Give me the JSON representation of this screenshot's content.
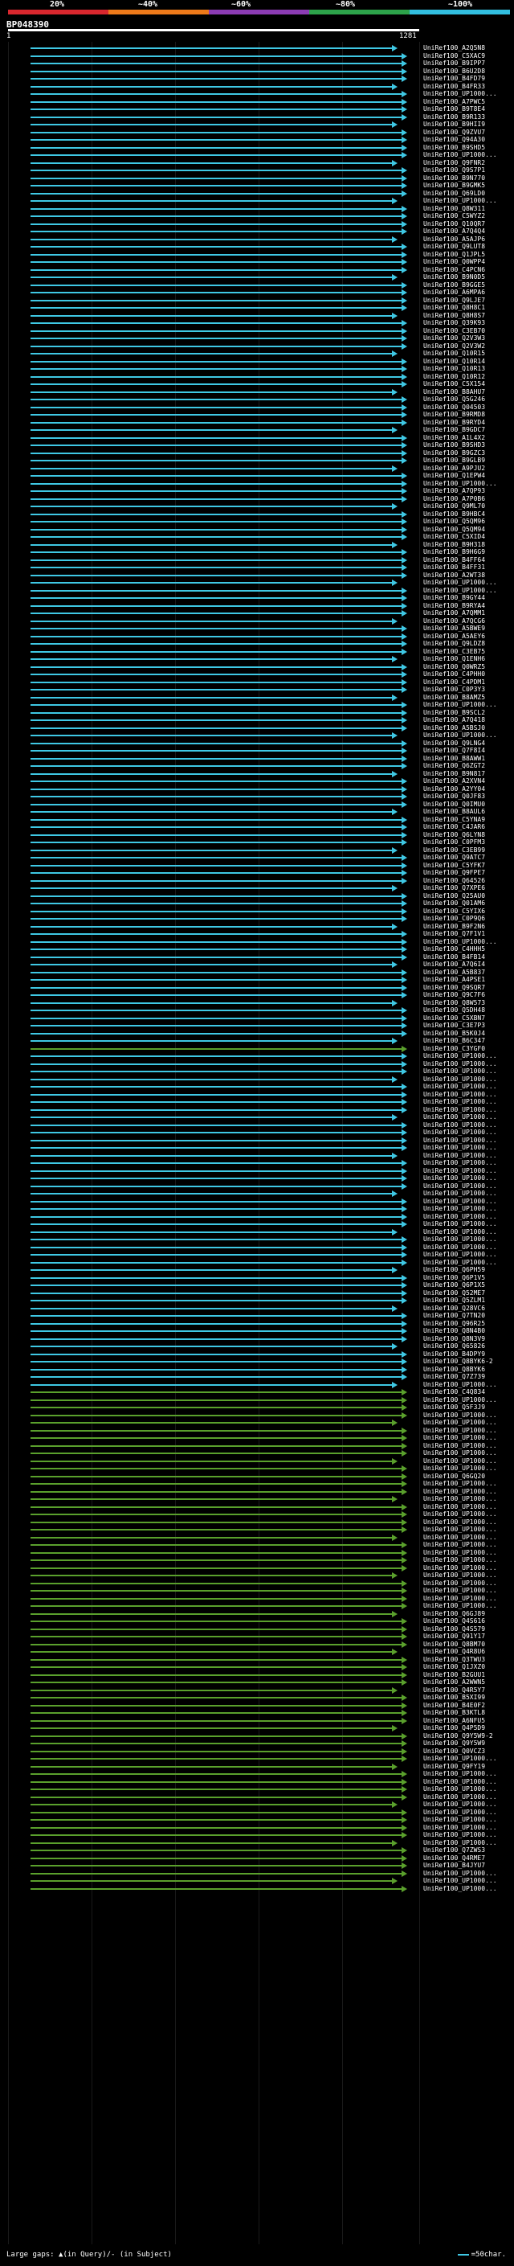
{
  "scale": {
    "labels": [
      "20%",
      "~40%",
      "~60%",
      "~80%",
      "~100%"
    ],
    "colors": [
      "#d9272e",
      "#ee7a1a",
      "#8c3cb4",
      "#2da34a",
      "#32bfe0"
    ]
  },
  "query": {
    "id": "BP048390",
    "start": "1",
    "end": "1281"
  },
  "colors": {
    "cyan": "#3fc8e4",
    "green": "#5aa02c",
    "grey": "#4a4a4a"
  },
  "rows": [
    {
      "label": "UniRef100_A2Q5N8",
      "color": "cyan"
    },
    {
      "label": "UniRef100_C5XAC9",
      "color": "cyan"
    },
    {
      "label": "UniRef100_B9IPP7",
      "color": "cyan"
    },
    {
      "label": "UniRef100_B6U2D8",
      "color": "cyan"
    },
    {
      "label": "UniRef100_B4FD79",
      "color": "cyan"
    },
    {
      "label": "UniRef100_B4FR33",
      "color": "cyan"
    },
    {
      "label": "UniRef100_UP1000...",
      "color": "cyan"
    },
    {
      "label": "UniRef100_A7PWC5",
      "color": "cyan"
    },
    {
      "label": "UniRef100_B9T8E4",
      "color": "cyan"
    },
    {
      "label": "UniRef100_B9R133",
      "color": "cyan"
    },
    {
      "label": "UniRef100_B9HII9",
      "color": "cyan"
    },
    {
      "label": "UniRef100_Q9ZVU7",
      "color": "cyan"
    },
    {
      "label": "UniRef100_Q94A30",
      "color": "cyan"
    },
    {
      "label": "UniRef100_B9SHD5",
      "color": "cyan"
    },
    {
      "label": "UniRef100_UP1000...",
      "color": "cyan"
    },
    {
      "label": "UniRef100_Q9FNR2",
      "color": "cyan"
    },
    {
      "label": "UniRef100_Q9S7P1",
      "color": "cyan"
    },
    {
      "label": "UniRef100_B9N770",
      "color": "cyan"
    },
    {
      "label": "UniRef100_B9GMK5",
      "color": "cyan"
    },
    {
      "label": "UniRef100_Q69LD0",
      "color": "cyan"
    },
    {
      "label": "UniRef100_UP1000...",
      "color": "cyan"
    },
    {
      "label": "UniRef100_Q8W311",
      "color": "cyan"
    },
    {
      "label": "UniRef100_C5WYZ2",
      "color": "cyan"
    },
    {
      "label": "UniRef100_Q10QR7",
      "color": "cyan"
    },
    {
      "label": "UniRef100_A7Q4Q4",
      "color": "cyan"
    },
    {
      "label": "UniRef100_A5AJP6",
      "color": "cyan"
    },
    {
      "label": "UniRef100_Q9LUT8",
      "color": "cyan"
    },
    {
      "label": "UniRef100_Q1JPL5",
      "color": "cyan"
    },
    {
      "label": "UniRef100_Q0WPP4",
      "color": "cyan"
    },
    {
      "label": "UniRef100_C4PCN6",
      "color": "cyan"
    },
    {
      "label": "UniRef100_B9N0D5",
      "color": "cyan"
    },
    {
      "label": "UniRef100_B9GGE5",
      "color": "cyan"
    },
    {
      "label": "UniRef100_A6MPA6",
      "color": "cyan"
    },
    {
      "label": "UniRef100_Q9LJE7",
      "color": "cyan"
    },
    {
      "label": "UniRef100_Q8H8C1",
      "color": "cyan"
    },
    {
      "label": "UniRef100_Q8H8S7",
      "color": "cyan"
    },
    {
      "label": "UniRef100_Q39K93",
      "color": "cyan"
    },
    {
      "label": "UniRef100_C3EB70",
      "color": "cyan"
    },
    {
      "label": "UniRef100_Q2V3W3",
      "color": "cyan"
    },
    {
      "label": "UniRef100_Q2V3W2",
      "color": "cyan"
    },
    {
      "label": "UniRef100_Q10R15",
      "color": "cyan"
    },
    {
      "label": "UniRef100_Q10R14",
      "color": "cyan"
    },
    {
      "label": "UniRef100_Q10R13",
      "color": "cyan"
    },
    {
      "label": "UniRef100_Q10R12",
      "color": "cyan"
    },
    {
      "label": "UniRef100_C5X154",
      "color": "cyan"
    },
    {
      "label": "UniRef100_B8AHU7",
      "color": "cyan"
    },
    {
      "label": "UniRef100_Q5G246",
      "color": "cyan"
    },
    {
      "label": "UniRef100_Q04503",
      "color": "cyan"
    },
    {
      "label": "UniRef100_B9RMD8",
      "color": "cyan"
    },
    {
      "label": "UniRef100_B9RYD4",
      "color": "cyan"
    },
    {
      "label": "UniRef100_B9GDC7",
      "color": "cyan"
    },
    {
      "label": "UniRef100_A1L4X2",
      "color": "cyan"
    },
    {
      "label": "UniRef100_B9SHD3",
      "color": "cyan"
    },
    {
      "label": "UniRef100_B9GZC3",
      "color": "cyan"
    },
    {
      "label": "UniRef100_B9GLB9",
      "color": "cyan"
    },
    {
      "label": "UniRef100_A9PJU2",
      "color": "cyan"
    },
    {
      "label": "UniRef100_Q1EPW4",
      "color": "cyan"
    },
    {
      "label": "UniRef100_UP1000...",
      "color": "cyan"
    },
    {
      "label": "UniRef100_A7QP93",
      "color": "cyan"
    },
    {
      "label": "UniRef100_A7P0B6",
      "color": "cyan"
    },
    {
      "label": "UniRef100_Q9ML70",
      "color": "cyan"
    },
    {
      "label": "UniRef100_B9HBC4",
      "color": "cyan"
    },
    {
      "label": "UniRef100_Q5QM96",
      "color": "cyan"
    },
    {
      "label": "UniRef100_Q5QM94",
      "color": "cyan"
    },
    {
      "label": "UniRef100_C5XID4",
      "color": "cyan"
    },
    {
      "label": "UniRef100_B9H318",
      "color": "cyan"
    },
    {
      "label": "UniRef100_B9H6G9",
      "color": "cyan"
    },
    {
      "label": "UniRef100_B4FF64",
      "color": "cyan"
    },
    {
      "label": "UniRef100_B4FF31",
      "color": "cyan"
    },
    {
      "label": "UniRef100_A2WT38",
      "color": "cyan"
    },
    {
      "label": "UniRef100_UP1000...",
      "color": "cyan"
    },
    {
      "label": "UniRef100_UP1000...",
      "color": "cyan"
    },
    {
      "label": "UniRef100_B9GY44",
      "color": "cyan"
    },
    {
      "label": "UniRef100_B9RYA4",
      "color": "cyan"
    },
    {
      "label": "UniRef100_A7QMM1",
      "color": "cyan"
    },
    {
      "label": "UniRef100_A7QCG6",
      "color": "cyan"
    },
    {
      "label": "UniRef100_A5BWE9",
      "color": "cyan"
    },
    {
      "label": "UniRef100_A5AEY6",
      "color": "cyan"
    },
    {
      "label": "UniRef100_Q9LDZ8",
      "color": "cyan"
    },
    {
      "label": "UniRef100_C3EB75",
      "color": "cyan"
    },
    {
      "label": "UniRef100_Q1ENH6",
      "color": "cyan"
    },
    {
      "label": "UniRef100_Q0WRZ5",
      "color": "cyan"
    },
    {
      "label": "UniRef100_C4PHH0",
      "color": "cyan"
    },
    {
      "label": "UniRef100_C4PDM1",
      "color": "cyan"
    },
    {
      "label": "UniRef100_C0P3Y3",
      "color": "cyan"
    },
    {
      "label": "UniRef100_B8AMZ5",
      "color": "cyan"
    },
    {
      "label": "UniRef100_UP1000...",
      "color": "cyan"
    },
    {
      "label": "UniRef100_B9SCL2",
      "color": "cyan"
    },
    {
      "label": "UniRef100_A7Q418",
      "color": "cyan"
    },
    {
      "label": "UniRef100_A5BSJ0",
      "color": "cyan"
    },
    {
      "label": "UniRef100_UP1000...",
      "color": "cyan"
    },
    {
      "label": "UniRef100_Q9LNG4",
      "color": "cyan"
    },
    {
      "label": "UniRef100_Q7F8I4",
      "color": "cyan"
    },
    {
      "label": "UniRef100_B8AWW1",
      "color": "cyan"
    },
    {
      "label": "UniRef100_Q6ZGT2",
      "color": "cyan"
    },
    {
      "label": "UniRef100_B9N817",
      "color": "cyan"
    },
    {
      "label": "UniRef100_A2XVN4",
      "color": "cyan"
    },
    {
      "label": "UniRef100_A2YY04",
      "color": "cyan"
    },
    {
      "label": "UniRef100_Q0JF83",
      "color": "cyan"
    },
    {
      "label": "UniRef100_Q0IMU0",
      "color": "cyan"
    },
    {
      "label": "UniRef100_B8AUL6",
      "color": "cyan"
    },
    {
      "label": "UniRef100_C5YNA9",
      "color": "cyan"
    },
    {
      "label": "UniRef100_C4JAR6",
      "color": "cyan"
    },
    {
      "label": "UniRef100_Q6LYN8",
      "color": "cyan"
    },
    {
      "label": "UniRef100_C0PFM3",
      "color": "cyan"
    },
    {
      "label": "UniRef100_C3EB99",
      "color": "cyan"
    },
    {
      "label": "UniRef100_Q9ATC7",
      "color": "cyan"
    },
    {
      "label": "UniRef100_C5YFK7",
      "color": "cyan"
    },
    {
      "label": "UniRef100_Q9FPE7",
      "color": "cyan"
    },
    {
      "label": "UniRef100_Q64526",
      "color": "cyan"
    },
    {
      "label": "UniRef100_Q7XPE6",
      "color": "cyan"
    },
    {
      "label": "UniRef100_Q25AU0",
      "color": "cyan"
    },
    {
      "label": "UniRef100_Q01AM6",
      "color": "cyan"
    },
    {
      "label": "UniRef100_C5YIX6",
      "color": "cyan"
    },
    {
      "label": "UniRef100_C0P9Q6",
      "color": "cyan"
    },
    {
      "label": "UniRef100_B9F2N6",
      "color": "cyan"
    },
    {
      "label": "UniRef100_Q7F1V1",
      "color": "cyan"
    },
    {
      "label": "UniRef100_UP1000...",
      "color": "cyan"
    },
    {
      "label": "UniRef100_C4HHH5",
      "color": "cyan"
    },
    {
      "label": "UniRef100_B4FB14",
      "color": "cyan"
    },
    {
      "label": "UniRef100_A7Q6I4",
      "color": "cyan"
    },
    {
      "label": "UniRef100_A5B837",
      "color": "cyan"
    },
    {
      "label": "UniRef100_A4PSE1",
      "color": "cyan"
    },
    {
      "label": "UniRef100_Q9SQR7",
      "color": "cyan"
    },
    {
      "label": "UniRef100_Q9C7F6",
      "color": "cyan"
    },
    {
      "label": "UniRef100_Q8W573",
      "color": "cyan"
    },
    {
      "label": "UniRef100_Q5DH48",
      "color": "cyan"
    },
    {
      "label": "UniRef100_C5XBN7",
      "color": "cyan"
    },
    {
      "label": "UniRef100_C3E7P3",
      "color": "cyan"
    },
    {
      "label": "UniRef100_B5K0J4",
      "color": "cyan"
    },
    {
      "label": "UniRef100_B6C347",
      "color": "cyan"
    },
    {
      "label": "UniRef100_C3YGF0",
      "color": "green"
    },
    {
      "label": "UniRef100_UP1000...",
      "color": "cyan"
    },
    {
      "label": "UniRef100_UP1000...",
      "color": "cyan"
    },
    {
      "label": "UniRef100_UP1000...",
      "color": "cyan"
    },
    {
      "label": "UniRef100_UP1000...",
      "color": "cyan"
    },
    {
      "label": "UniRef100_UP1000...",
      "color": "cyan"
    },
    {
      "label": "UniRef100_UP1000...",
      "color": "cyan"
    },
    {
      "label": "UniRef100_UP1000...",
      "color": "cyan"
    },
    {
      "label": "UniRef100_UP1000...",
      "color": "cyan"
    },
    {
      "label": "UniRef100_UP1000...",
      "color": "cyan"
    },
    {
      "label": "UniRef100_UP1000...",
      "color": "cyan"
    },
    {
      "label": "UniRef100_UP1000...",
      "color": "cyan"
    },
    {
      "label": "UniRef100_UP1000...",
      "color": "cyan"
    },
    {
      "label": "UniRef100_UP1000...",
      "color": "cyan"
    },
    {
      "label": "UniRef100_UP1000...",
      "color": "cyan"
    },
    {
      "label": "UniRef100_UP1000...",
      "color": "cyan"
    },
    {
      "label": "UniRef100_UP1000...",
      "color": "cyan"
    },
    {
      "label": "UniRef100_UP1000...",
      "color": "cyan"
    },
    {
      "label": "UniRef100_UP1000...",
      "color": "cyan"
    },
    {
      "label": "UniRef100_UP1000...",
      "color": "cyan"
    },
    {
      "label": "UniRef100_UP1000...",
      "color": "cyan"
    },
    {
      "label": "UniRef100_UP1000...",
      "color": "cyan"
    },
    {
      "label": "UniRef100_UP1000...",
      "color": "cyan"
    },
    {
      "label": "UniRef100_UP1000...",
      "color": "cyan"
    },
    {
      "label": "UniRef100_UP1000...",
      "color": "cyan"
    },
    {
      "label": "UniRef100_UP1000...",
      "color": "cyan"
    },
    {
      "label": "UniRef100_UP1000...",
      "color": "cyan"
    },
    {
      "label": "UniRef100_UP1000...",
      "color": "cyan"
    },
    {
      "label": "UniRef100_UP1000...",
      "color": "cyan"
    },
    {
      "label": "UniRef100_Q6PH59",
      "color": "cyan"
    },
    {
      "label": "UniRef100_Q6P1V5",
      "color": "cyan"
    },
    {
      "label": "UniRef100_Q6P1X5",
      "color": "cyan"
    },
    {
      "label": "UniRef100_Q52ME7",
      "color": "cyan"
    },
    {
      "label": "UniRef100_Q5ZLM1",
      "color": "cyan"
    },
    {
      "label": "UniRef100_Q28VC6",
      "color": "cyan"
    },
    {
      "label": "UniRef100_Q7TN20",
      "color": "cyan"
    },
    {
      "label": "UniRef100_Q96R25",
      "color": "cyan"
    },
    {
      "label": "UniRef100_Q8N4B0",
      "color": "cyan"
    },
    {
      "label": "UniRef100_Q8N3V9",
      "color": "cyan"
    },
    {
      "label": "UniRef100_Q65826",
      "color": "cyan"
    },
    {
      "label": "UniRef100_B4DPY9",
      "color": "cyan"
    },
    {
      "label": "UniRef100_Q8BYK6-2",
      "color": "cyan"
    },
    {
      "label": "UniRef100_Q8BYK6",
      "color": "cyan"
    },
    {
      "label": "UniRef100_Q7Z739",
      "color": "cyan"
    },
    {
      "label": "UniRef100_UP1000...",
      "color": "cyan"
    },
    {
      "label": "UniRef100_C4Q834",
      "color": "green"
    },
    {
      "label": "UniRef100_UP1000...",
      "color": "green"
    },
    {
      "label": "UniRef100_Q5F3J9",
      "color": "green"
    },
    {
      "label": "UniRef100_UP1000...",
      "color": "green"
    },
    {
      "label": "UniRef100_UP1000...",
      "color": "green"
    },
    {
      "label": "UniRef100_UP1000...",
      "color": "green"
    },
    {
      "label": "UniRef100_UP1000...",
      "color": "green"
    },
    {
      "label": "UniRef100_UP1000...",
      "color": "green"
    },
    {
      "label": "UniRef100_UP1000...",
      "color": "green"
    },
    {
      "label": "UniRef100_UP1000...",
      "color": "green"
    },
    {
      "label": "UniRef100_UP1000...",
      "color": "green"
    },
    {
      "label": "UniRef100_Q6GQ20",
      "color": "green"
    },
    {
      "label": "UniRef100_UP1000...",
      "color": "green"
    },
    {
      "label": "UniRef100_UP1000...",
      "color": "green"
    },
    {
      "label": "UniRef100_UP1000...",
      "color": "green"
    },
    {
      "label": "UniRef100_UP1000...",
      "color": "green"
    },
    {
      "label": "UniRef100_UP1000...",
      "color": "green"
    },
    {
      "label": "UniRef100_UP1000...",
      "color": "green"
    },
    {
      "label": "UniRef100_UP1000...",
      "color": "green"
    },
    {
      "label": "UniRef100_UP1000...",
      "color": "green"
    },
    {
      "label": "UniRef100_UP1000...",
      "color": "green"
    },
    {
      "label": "UniRef100_UP1000...",
      "color": "green"
    },
    {
      "label": "UniRef100_UP1000...",
      "color": "green"
    },
    {
      "label": "UniRef100_UP1000...",
      "color": "green"
    },
    {
      "label": "UniRef100_UP1000...",
      "color": "green"
    },
    {
      "label": "UniRef100_UP1000...",
      "color": "green"
    },
    {
      "label": "UniRef100_UP1000...",
      "color": "green"
    },
    {
      "label": "UniRef100_UP1000...",
      "color": "green"
    },
    {
      "label": "UniRef100_UP1000...",
      "color": "green"
    },
    {
      "label": "UniRef100_Q6GJ89",
      "color": "green"
    },
    {
      "label": "UniRef100_Q4S616",
      "color": "green"
    },
    {
      "label": "UniRef100_Q4S579",
      "color": "green"
    },
    {
      "label": "UniRef100_Q91Y17",
      "color": "green"
    },
    {
      "label": "UniRef100_Q8BM70",
      "color": "green"
    },
    {
      "label": "UniRef100_Q4R8U6",
      "color": "green"
    },
    {
      "label": "UniRef100_Q3TWU3",
      "color": "green"
    },
    {
      "label": "UniRef100_Q1JXZ0",
      "color": "green"
    },
    {
      "label": "UniRef100_B2GUU1",
      "color": "green"
    },
    {
      "label": "UniRef100_A2WWN5",
      "color": "green"
    },
    {
      "label": "UniRef100_Q4R5Y7",
      "color": "green"
    },
    {
      "label": "UniRef100_B5XI99",
      "color": "green"
    },
    {
      "label": "UniRef100_B4E0F2",
      "color": "green"
    },
    {
      "label": "UniRef100_B3KTL8",
      "color": "green"
    },
    {
      "label": "UniRef100_A6NFU5",
      "color": "green"
    },
    {
      "label": "UniRef100_Q4P5D9",
      "color": "green"
    },
    {
      "label": "UniRef100_Q9Y5W9-2",
      "color": "green"
    },
    {
      "label": "UniRef100_Q9Y5W9",
      "color": "green"
    },
    {
      "label": "UniRef100_Q0VCZ3",
      "color": "green"
    },
    {
      "label": "UniRef100_UP1000...",
      "color": "green"
    },
    {
      "label": "UniRef100_Q9FY19",
      "color": "green"
    },
    {
      "label": "UniRef100_UP1000...",
      "color": "green"
    },
    {
      "label": "UniRef100_UP1000...",
      "color": "green"
    },
    {
      "label": "UniRef100_UP1000...",
      "color": "green"
    },
    {
      "label": "UniRef100_UP1000...",
      "color": "green"
    },
    {
      "label": "UniRef100_UP1000...",
      "color": "green"
    },
    {
      "label": "UniRef100_UP1000...",
      "color": "green"
    },
    {
      "label": "UniRef100_UP1000...",
      "color": "green"
    },
    {
      "label": "UniRef100_UP1000...",
      "color": "green"
    },
    {
      "label": "UniRef100_UP1000...",
      "color": "green"
    },
    {
      "label": "UniRef100_UP1000...",
      "color": "green"
    },
    {
      "label": "UniRef100_Q7ZWS3",
      "color": "green"
    },
    {
      "label": "UniRef100_Q4RME7",
      "color": "green"
    },
    {
      "label": "UniRef100_B4JYU7",
      "color": "green"
    },
    {
      "label": "UniRef100_UP1000...",
      "color": "green"
    },
    {
      "label": "UniRef100_UP1000...",
      "color": "green"
    },
    {
      "label": "UniRef100_UP1000...",
      "color": "green"
    }
  ],
  "footer": {
    "left": "Large gaps: ▲(in Query)/- (in Subject)",
    "right": "=50char."
  }
}
